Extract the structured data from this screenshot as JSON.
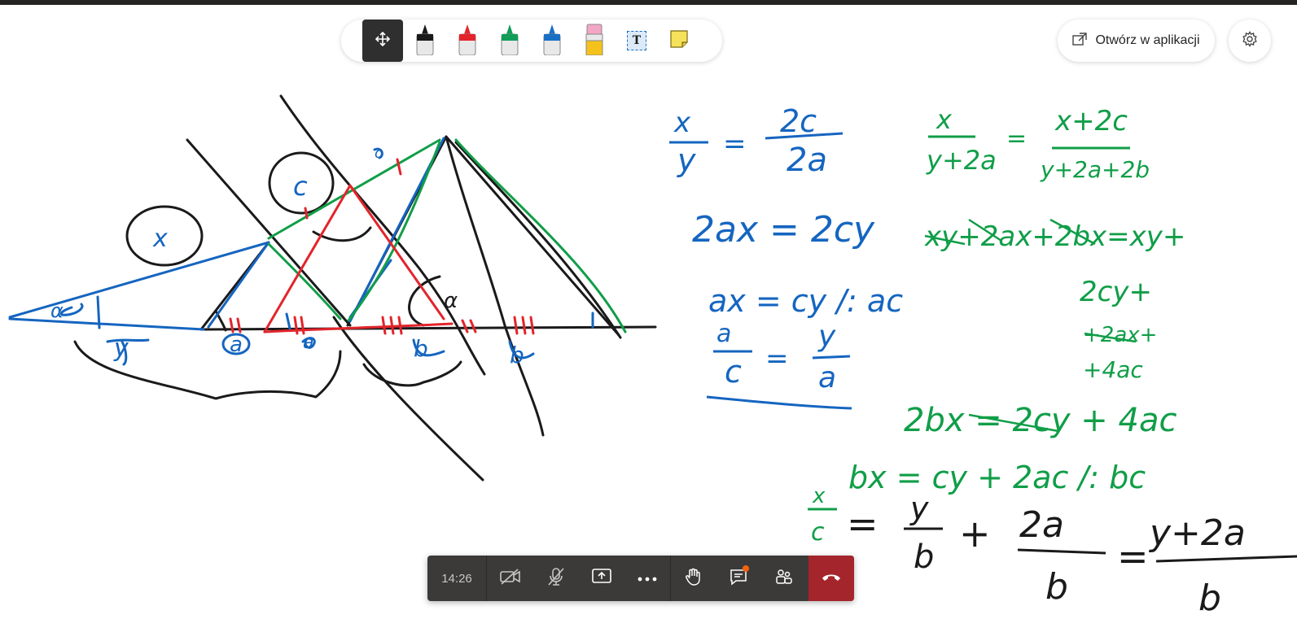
{
  "toolbar": {
    "tools": [
      {
        "name": "move-tool",
        "icon": "move-icon"
      },
      {
        "name": "pen-black",
        "icon": "pen-icon",
        "color": "#1a1a1a"
      },
      {
        "name": "pen-red",
        "icon": "pen-icon",
        "color": "#e3242b"
      },
      {
        "name": "pen-green",
        "icon": "pen-icon",
        "color": "#0f9d58"
      },
      {
        "name": "pen-blue",
        "icon": "pen-icon",
        "color": "#1a6fc4"
      },
      {
        "name": "highlighter",
        "icon": "highlighter-icon",
        "color": "#f4c21b"
      },
      {
        "name": "text-tool",
        "icon": "text-icon",
        "label": "T"
      },
      {
        "name": "sticky-note",
        "icon": "sticky-note-icon",
        "color": "#f6e25a"
      }
    ]
  },
  "header": {
    "open_in_app_label": "Otwórz w aplikacji"
  },
  "call": {
    "timer": "14:26",
    "buttons": [
      "camera-off-icon",
      "mic-off-icon",
      "share-screen-icon",
      "more-icon",
      "raise-hand-icon",
      "chat-icon",
      "participants-icon",
      "hang-up-icon"
    ],
    "chat_badge_color": "#f7630c",
    "hangup_color": "#a4262c"
  },
  "whiteboard": {
    "ink_colors": {
      "black": "#1a1a1a",
      "blue": "#1565c0",
      "green": "#109e48",
      "red": "#e3242b"
    },
    "labels": {
      "alpha": "α",
      "y": "y",
      "a1": "a",
      "a2": "a",
      "b1": "b",
      "b2": "b",
      "x_circle": "x",
      "c_circle": "c",
      "c_small": "c",
      "alpha2": "α"
    },
    "equations": {
      "eq1_num_left": "x",
      "eq1_den_left": "y",
      "eq1_eq": "=",
      "eq1_num_right": "2c",
      "eq1_den_right": "2a",
      "eq2": "2ax = 2cy",
      "eq3": "ax = cy /: ac",
      "eq4_num_left": "a",
      "eq4_den_left": "c",
      "eq4_eq": "=",
      "eq4_num_right": "y",
      "eq4_den_right": "a",
      "geq1_num_left": "x",
      "geq1_den_left": "y+2a",
      "geq1_eq": "=",
      "geq1_num_right": "x+2c",
      "geq1_den_right": "y+2a+2b",
      "geq2": "xy+2ax+2bx=xy+",
      "geq3a": "2cy+",
      "geq3b": "+2ax+",
      "geq3c": "+4ac",
      "geq4": "2bx = 2cy + 4ac",
      "geq5": "bx = cy + 2ac /: bc",
      "geq6_num_left": "x",
      "geq6_den_left": "c",
      "geq6_eq": "=",
      "geq6_num_mid": "y",
      "geq6_den_mid": "b",
      "geq6_plus": "+",
      "geq6_num_r": "2a",
      "geq6_den_r": "b",
      "geq6_eq2": "=",
      "geq6_num_end": "y+2a",
      "geq6_den_end": "b"
    }
  }
}
